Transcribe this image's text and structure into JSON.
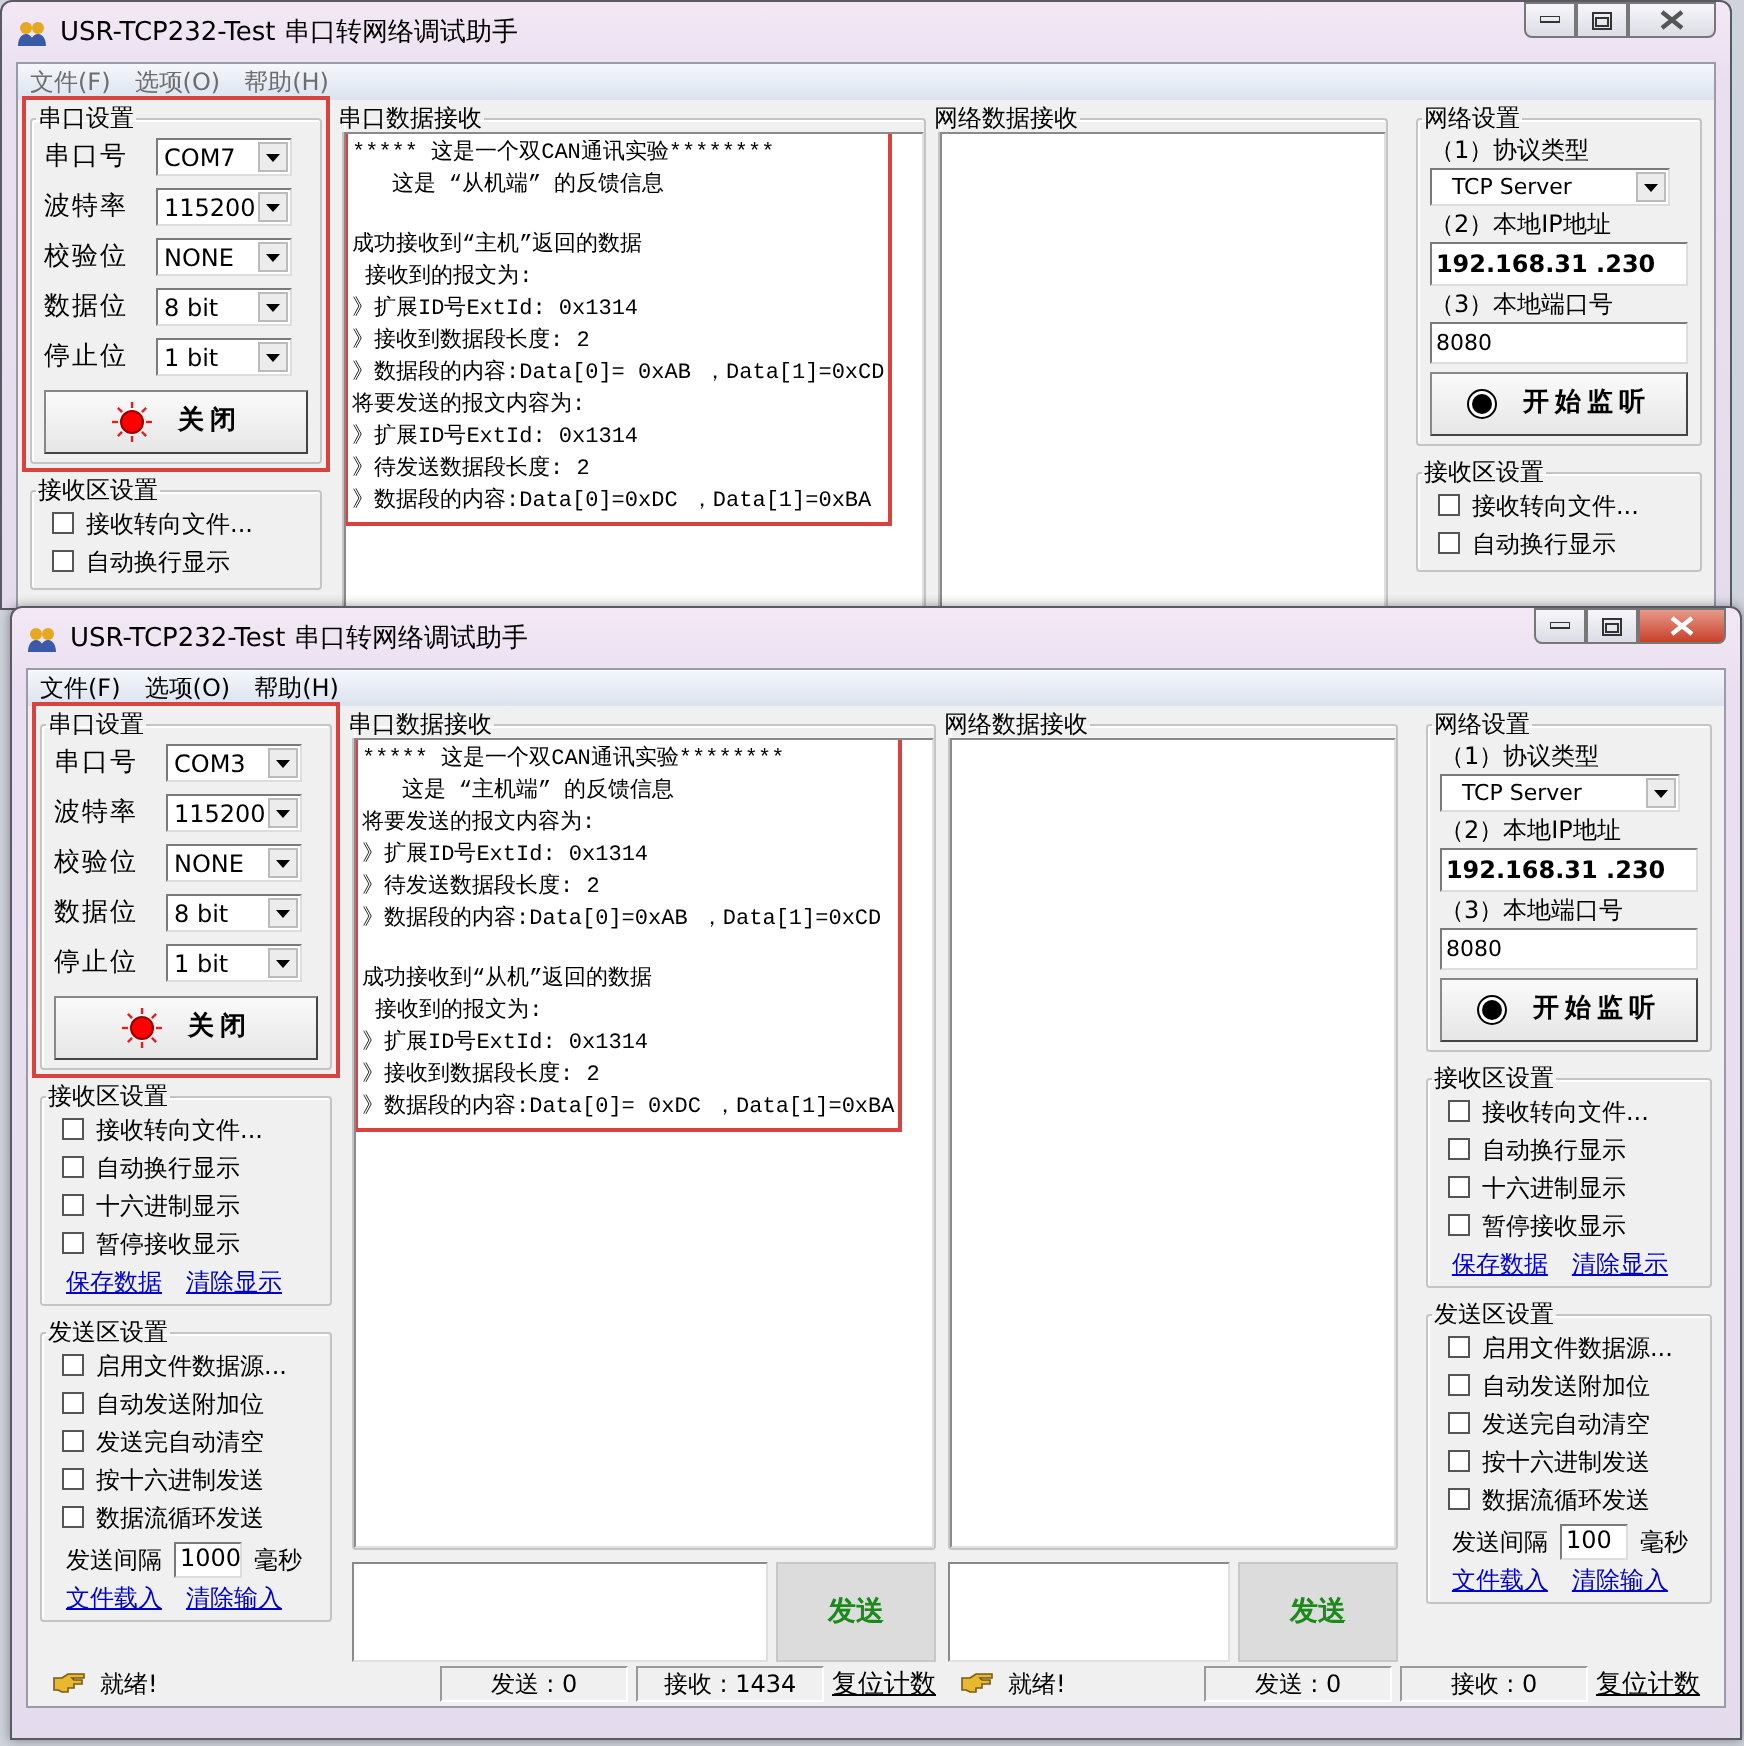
{
  "windows": [
    {
      "title": "USR-TCP232-Test 串口转网络调试助手",
      "active": false,
      "menu": [
        "文件(F)",
        "选项(O)",
        "帮助(H)"
      ],
      "serial_settings": {
        "title": "串口设置",
        "highlighted": true,
        "fields": [
          {
            "label": "串口号",
            "value": "COM7"
          },
          {
            "label": "波特率",
            "value": "115200"
          },
          {
            "label": "校验位",
            "value": "NONE"
          },
          {
            "label": "数据位",
            "value": "8 bit"
          },
          {
            "label": "停止位",
            "value": "1 bit"
          }
        ],
        "button": "关闭"
      },
      "receive_settings": {
        "title": "接收区设置",
        "options": [
          {
            "label": "接收转向文件...",
            "checked": false
          },
          {
            "label": "自动换行显示",
            "checked": false
          }
        ]
      },
      "serial_receive": {
        "title": "串口数据接收",
        "highlighted": true,
        "paragraphs": [
          [
            "***** 这是一个双CAN通讯实验********",
            "   这是 “从机端” 的反馈信息"
          ],
          [
            "成功接收到“主机”返回的数据",
            " 接收到的报文为:",
            "》扩展ID号ExtId: 0x1314",
            "》接收到数据段长度: 2",
            "》数据段的内容:Data[0]= 0xAB ，Data[1]=0xCD",
            "将要发送的报文内容为:",
            "》扩展ID号ExtId: 0x1314",
            "》待发送数据段长度: 2",
            "》数据段的内容:Data[0]=0xDC ，Data[1]=0xBA"
          ]
        ]
      },
      "network_receive": {
        "title": "网络数据接收"
      },
      "network_settings": {
        "title": "网络设置",
        "protocol_label": "（1）协议类型",
        "protocol": "TCP Server",
        "ip_label": "（2）本地IP地址",
        "ip": "192.168.31 .230",
        "port_label": "（3）本地端口号",
        "port": "8080",
        "button": "开始监听"
      },
      "net_receive_settings": {
        "title": "接收区设置",
        "options": [
          {
            "label": "接收转向文件...",
            "checked": false
          },
          {
            "label": "自动换行显示",
            "checked": false
          }
        ]
      }
    },
    {
      "title": "USR-TCP232-Test 串口转网络调试助手",
      "active": true,
      "menu": [
        "文件(F)",
        "选项(O)",
        "帮助(H)"
      ],
      "serial_settings": {
        "title": "串口设置",
        "highlighted": true,
        "fields": [
          {
            "label": "串口号",
            "value": "COM3"
          },
          {
            "label": "波特率",
            "value": "115200"
          },
          {
            "label": "校验位",
            "value": "NONE"
          },
          {
            "label": "数据位",
            "value": "8 bit"
          },
          {
            "label": "停止位",
            "value": "1 bit"
          }
        ],
        "button": "关闭"
      },
      "receive_settings": {
        "title": "接收区设置",
        "options": [
          {
            "label": "接收转向文件...",
            "checked": false
          },
          {
            "label": "自动换行显示",
            "checked": false
          },
          {
            "label": "十六进制显示",
            "checked": false
          },
          {
            "label": "暂停接收显示",
            "checked": false
          }
        ],
        "links": [
          "保存数据",
          "清除显示"
        ]
      },
      "send_settings": {
        "title": "发送区设置",
        "options": [
          {
            "label": "启用文件数据源...",
            "checked": false
          },
          {
            "label": "自动发送附加位",
            "checked": false
          },
          {
            "label": "发送完自动清空",
            "checked": false
          },
          {
            "label": "按十六进制发送",
            "checked": false
          },
          {
            "label": "数据流循环发送",
            "checked": false
          }
        ],
        "interval_label": "发送间隔",
        "interval": "1000",
        "interval_unit": "毫秒",
        "links": [
          "文件载入",
          "清除输入"
        ]
      },
      "serial_receive": {
        "title": "串口数据接收",
        "highlighted": true,
        "paragraphs": [
          [
            "***** 这是一个双CAN通讯实验********",
            "   这是 “主机端” 的反馈信息",
            "将要发送的报文内容为:",
            "》扩展ID号ExtId: 0x1314",
            "》待发送数据段长度: 2",
            "》数据段的内容:Data[0]=0xAB ，Data[1]=0xCD"
          ],
          [
            "成功接收到“从机”返回的数据",
            " 接收到的报文为:",
            "》扩展ID号ExtId: 0x1314",
            "》接收到数据段长度: 2",
            "》数据段的内容:Data[0]= 0xDC ，Data[1]=0xBA"
          ]
        ],
        "send_button": "发送"
      },
      "network_receive": {
        "title": "网络数据接收",
        "send_button": "发送"
      },
      "network_settings": {
        "title": "网络设置",
        "protocol_label": "（1）协议类型",
        "protocol": "TCP Server",
        "ip_label": "（2）本地IP地址",
        "ip": "192.168.31 .230",
        "port_label": "（3）本地端口号",
        "port": "8080",
        "button": "开始监听"
      },
      "net_receive_settings": {
        "title": "接收区设置",
        "options": [
          {
            "label": "接收转向文件...",
            "checked": false
          },
          {
            "label": "自动换行显示",
            "checked": false
          },
          {
            "label": "十六进制显示",
            "checked": false
          },
          {
            "label": "暂停接收显示",
            "checked": false
          }
        ],
        "links": [
          "保存数据",
          "清除显示"
        ]
      },
      "net_send_settings": {
        "title": "发送区设置",
        "options": [
          {
            "label": "启用文件数据源...",
            "checked": false
          },
          {
            "label": "自动发送附加位",
            "checked": false
          },
          {
            "label": "发送完自动清空",
            "checked": false
          },
          {
            "label": "按十六进制发送",
            "checked": false
          },
          {
            "label": "数据流循环发送",
            "checked": false
          }
        ],
        "interval_label": "发送间隔",
        "interval": "100",
        "interval_unit": "毫秒",
        "links": [
          "文件载入",
          "清除输入"
        ]
      },
      "status_bars": [
        {
          "status": "就绪!",
          "sent": "发送 : 0",
          "received": "接收 : 1434",
          "reset": "复位计数"
        },
        {
          "status": "就绪!",
          "sent": "发送 : 0",
          "received": "接收 : 0",
          "reset": "复位计数"
        }
      ]
    }
  ]
}
